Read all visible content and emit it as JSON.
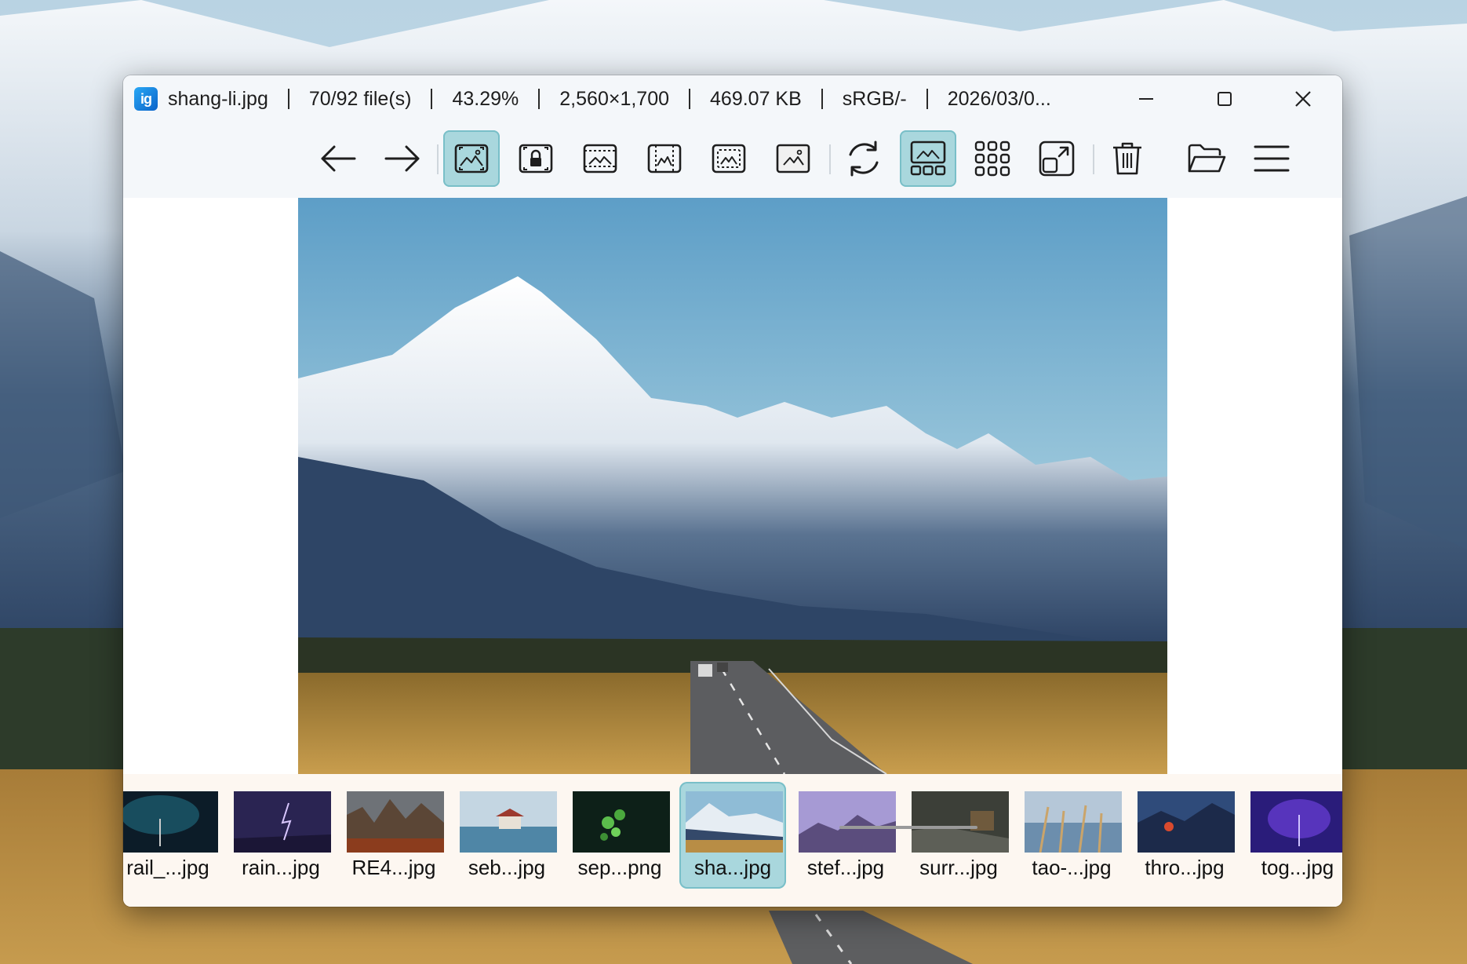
{
  "window": {
    "filename": "shang-li.jpg",
    "file_index": "70/92 file(s)",
    "zoom": "43.29%",
    "dimensions": "2,560×1,700",
    "file_size": "469.07 KB",
    "color_profile": "sRGB/-",
    "date": "2026/03/0..."
  },
  "app_logo_text": "ig",
  "window_controls": [
    "minimize-icon",
    "maximize-icon",
    "close-icon"
  ],
  "toolbar": {
    "tools": [
      {
        "name": "previous-image-button",
        "icon": "arrow-left-icon",
        "active": false
      },
      {
        "name": "next-image-button",
        "icon": "arrow-right-icon",
        "active": false
      },
      {
        "name": "auto-zoom-button",
        "icon": "auto-zoom-icon",
        "active": true
      },
      {
        "name": "lock-zoom-button",
        "icon": "lock-zoom-icon",
        "active": false
      },
      {
        "name": "scale-to-width-button",
        "icon": "scale-to-width-icon",
        "active": false
      },
      {
        "name": "scale-to-height-button",
        "icon": "scale-to-height-icon",
        "active": false
      },
      {
        "name": "scale-to-fit-button",
        "icon": "scale-to-fit-icon",
        "active": false
      },
      {
        "name": "actual-size-button",
        "icon": "actual-size-icon",
        "active": false
      },
      {
        "name": "refresh-button",
        "icon": "refresh-icon",
        "active": false
      },
      {
        "name": "gallery-toggle-button",
        "icon": "gallery-icon",
        "active": true
      },
      {
        "name": "grid-view-button",
        "icon": "grid-icon",
        "active": false
      },
      {
        "name": "open-external-button",
        "icon": "open-external-icon",
        "active": false
      },
      {
        "name": "delete-button",
        "icon": "trash-icon",
        "active": false
      },
      {
        "name": "open-file-button",
        "icon": "folder-open-icon",
        "active": false
      },
      {
        "name": "main-menu-button",
        "icon": "hamburger-menu-icon",
        "active": false
      }
    ]
  },
  "thumbnails": [
    {
      "label": "rail_...jpg",
      "selected": false
    },
    {
      "label": "rain...jpg",
      "selected": false
    },
    {
      "label": "RE4...jpg",
      "selected": false
    },
    {
      "label": "seb...jpg",
      "selected": false
    },
    {
      "label": "sep...png",
      "selected": false
    },
    {
      "label": "sha...jpg",
      "selected": true
    },
    {
      "label": "stef...jpg",
      "selected": false
    },
    {
      "label": "surr...jpg",
      "selected": false
    },
    {
      "label": "tao-...jpg",
      "selected": false
    },
    {
      "label": "thro...jpg",
      "selected": false
    },
    {
      "label": "tog...jpg",
      "selected": false
    }
  ],
  "colors": {
    "active_tool_bg": "#a9d7dd",
    "toolbar_bg": "#f4f7fa",
    "filmstrip_bg": "#fdf7f1"
  }
}
